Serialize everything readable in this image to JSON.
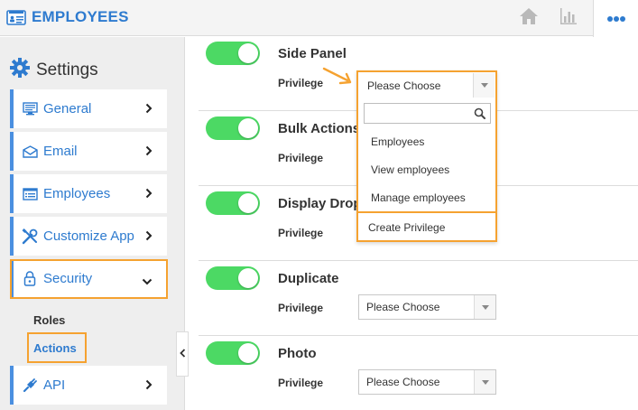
{
  "header": {
    "title": "EMPLOYEES",
    "icons": {
      "app": "id-card-icon",
      "home": "home-icon",
      "chart": "bar-chart-icon",
      "more": "more-dots-icon"
    },
    "accent": "#2e7bcf"
  },
  "sidebar": {
    "title": "Settings",
    "items": [
      {
        "label": "General",
        "icon": "monitor-icon"
      },
      {
        "label": "Email",
        "icon": "envelope-icon"
      },
      {
        "label": "Employees",
        "icon": "list-window-icon"
      },
      {
        "label": "Customize App",
        "icon": "tools-icon"
      },
      {
        "label": "Security",
        "icon": "lock-icon"
      },
      {
        "label": "API",
        "icon": "plug-icon"
      }
    ],
    "subitems": [
      "Roles",
      "Actions"
    ],
    "active_subitem": "Actions"
  },
  "rows": [
    {
      "title": "Side Panel",
      "privilege_label": "Privilege",
      "value": "Please Choose",
      "enabled": true
    },
    {
      "title": "Bulk Actions",
      "privilege_label": "Privilege",
      "value": "",
      "enabled": true
    },
    {
      "title": "Display Drop",
      "privilege_label": "Privilege",
      "value": "",
      "enabled": true
    },
    {
      "title": "Duplicate",
      "privilege_label": "Privilege",
      "value": "Please Choose",
      "enabled": true
    },
    {
      "title": "Photo",
      "privilege_label": "Privilege",
      "value": "Please Choose",
      "enabled": true
    }
  ],
  "dropdown": {
    "selected": "Please Choose",
    "search_placeholder": "",
    "options": [
      "Employees",
      "View employees",
      "Manage employees"
    ],
    "create_label": "Create Privilege"
  },
  "colors": {
    "toggle_on": "#4cd964",
    "highlight": "#f5a230",
    "link": "#2e7bcf"
  }
}
